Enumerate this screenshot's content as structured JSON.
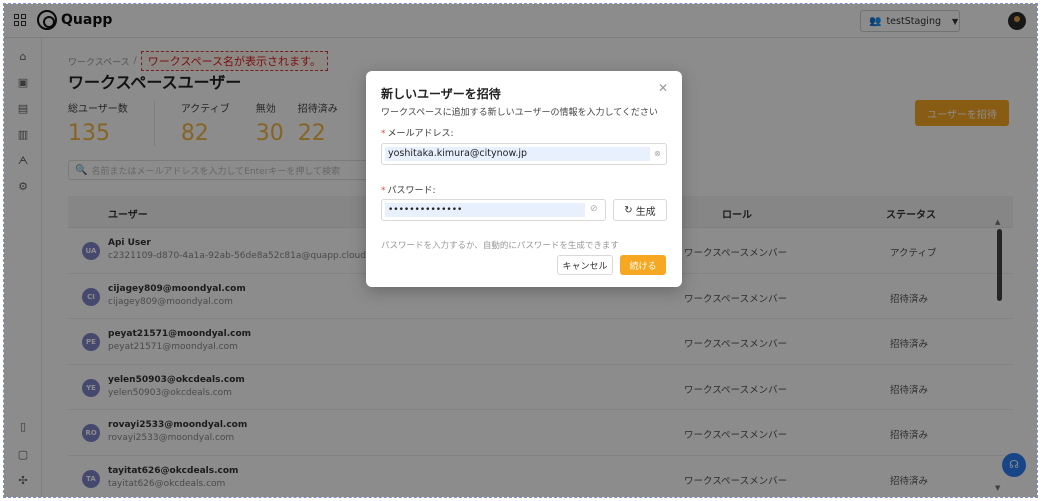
{
  "app": {
    "name": "Quapp"
  },
  "header": {
    "workspace_select": "testStaging"
  },
  "breadcrumb": {
    "root": "ワークスペース",
    "separator": "/",
    "annotation": "ワークスペース名が表示されます。"
  },
  "page": {
    "title": "ワークスペースユーザー"
  },
  "stats": {
    "total_label": "総ユーザー数",
    "total_value": "135",
    "active_label": "アクティブ",
    "active_value": "82",
    "inactive_label": "無効",
    "inactive_value": "30",
    "invited_label": "招待済み",
    "invited_value": "22"
  },
  "invite_button": "ユーザーを招待",
  "search": {
    "placeholder": "名前またはメールアドレスを入力してEnterキーを押して検索"
  },
  "table": {
    "headers": {
      "user": "ユーザー",
      "role": "ロール",
      "status": "ステータス"
    },
    "rows": [
      {
        "initials": "UA",
        "name": "Api User",
        "email": "c2321109-d870-4a1a-92ab-56de8a52c81a@quapp.cloud",
        "role": "ワークスペースメンバー",
        "status": "アクティブ"
      },
      {
        "initials": "CI",
        "name": "cijagey809@moondyal.com",
        "email": "cijagey809@moondyal.com",
        "role": "ワークスペースメンバー",
        "status": "招待済み"
      },
      {
        "initials": "PE",
        "name": "peyat21571@moondyal.com",
        "email": "peyat21571@moondyal.com",
        "role": "ワークスペースメンバー",
        "status": "招待済み"
      },
      {
        "initials": "YE",
        "name": "yelen50903@okcdeals.com",
        "email": "yelen50903@okcdeals.com",
        "role": "ワークスペースメンバー",
        "status": "招待済み"
      },
      {
        "initials": "RO",
        "name": "rovayi2533@moondyal.com",
        "email": "rovayi2533@moondyal.com",
        "role": "ワークスペースメンバー",
        "status": "招待済み"
      },
      {
        "initials": "TA",
        "name": "tayitat626@okcdeals.com",
        "email": "tayitat626@okcdeals.com",
        "role": "ワークスペースメンバー",
        "status": "招待済み"
      }
    ]
  },
  "modal": {
    "title": "新しいユーザーを招待",
    "description": "ワークスペースに追加する新しいユーザーの情報を入力してください",
    "email_label": "メールアドレス:",
    "email_value": "yoshitaka.kimura@citynow.jp",
    "password_label": "パスワード:",
    "password_value": "••••••••••••••",
    "generate_button": "生成",
    "hint": "パスワードを入力するか、自動的にパスワードを生成できます",
    "cancel_button": "キャンセル",
    "continue_button": "続ける"
  },
  "colors": {
    "accent": "#f7a822",
    "stat": "#f5b642",
    "avatar": "#7f86c9",
    "help": "#2d7ef7"
  }
}
